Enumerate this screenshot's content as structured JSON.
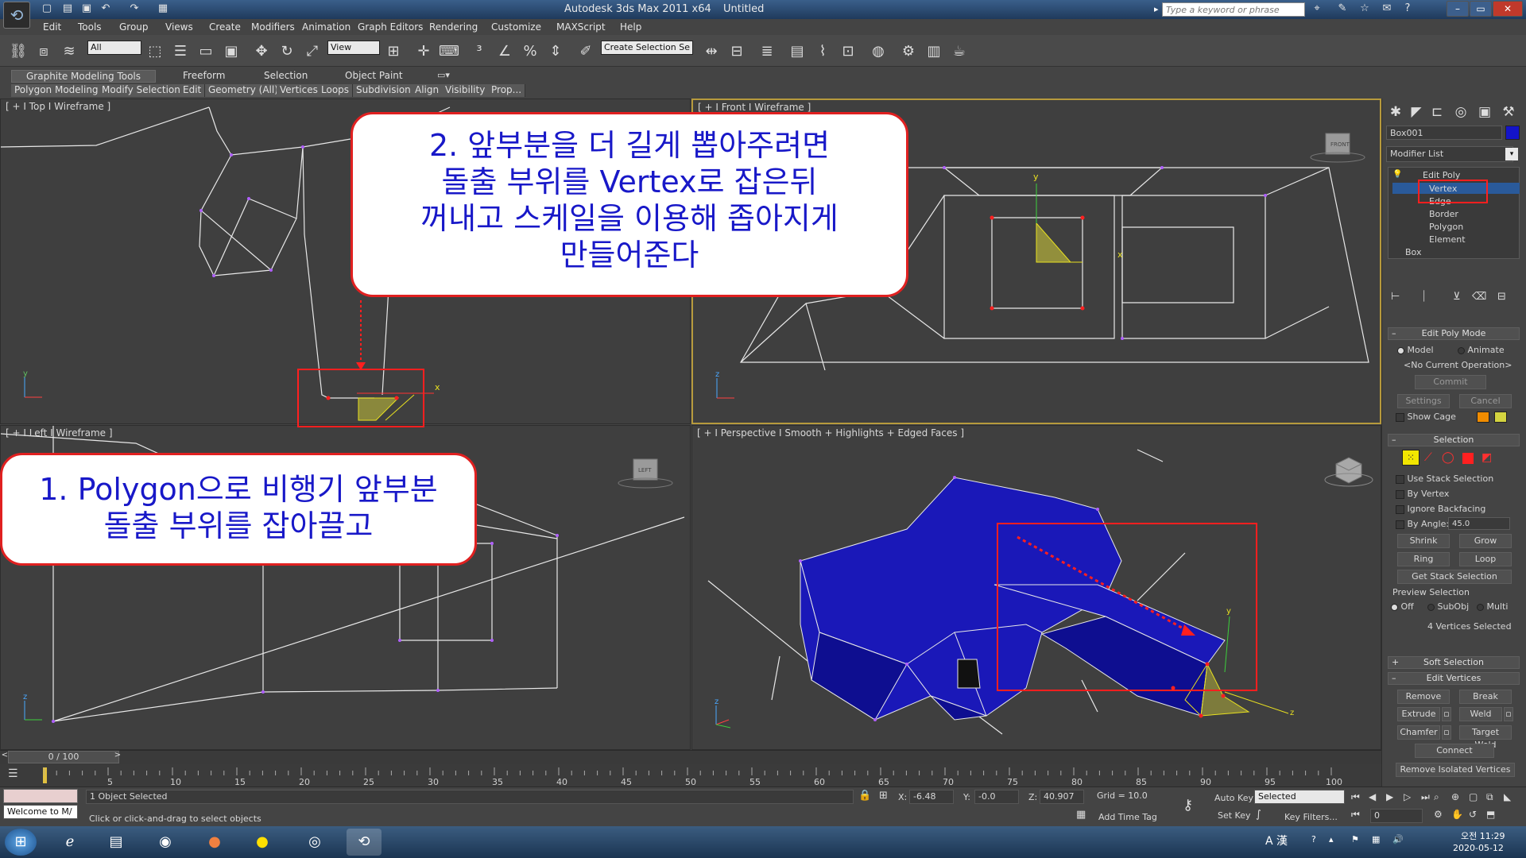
{
  "title_bar": {
    "app_title": "Autodesk 3ds Max  2011 x64",
    "document_title": "Untitled",
    "search_placeholder": "Type a keyword or phrase"
  },
  "menu": [
    "Edit",
    "Tools",
    "Group",
    "Views",
    "Create",
    "Modifiers",
    "Animation",
    "Graph Editors",
    "Rendering",
    "Customize",
    "MAXScript",
    "Help"
  ],
  "toolbar": {
    "selection_filter": "All",
    "reference_coord": "View",
    "named_selection_placeholder": "Create Selection Se"
  },
  "ribbon": {
    "tabs": [
      "Graphite Modeling Tools",
      "Freeform",
      "Selection",
      "Object Paint"
    ],
    "subtabs": [
      "Polygon Modeling",
      "Modify Selection",
      "Edit",
      "Geometry (All)",
      "Vertices",
      "Loops",
      "Subdivision",
      "Align",
      "Visibility",
      "Prop..."
    ]
  },
  "viewports": {
    "top": "[ + Ι Top Ι Wireframe ]",
    "front": "[ + Ι Front Ι Wireframe ]",
    "left": "[ + Ι Left Ι Wireframe ]",
    "perspective": "[ + Ι Perspective Ι Smooth + Highlights + Edged Faces ]",
    "viewcube_front": "FRONT",
    "viewcube_left": "LEFT"
  },
  "annotations": {
    "step1_line1": "1. Polygon으로 비행기 앞부분",
    "step1_line2": "돌출 부위를 잡아끌고",
    "step2_line1": "2. 앞부분을 더 길게 뽑아주려면",
    "step2_line2": "돌출 부위를 Vertex로 잡은뒤",
    "step2_line3": "꺼내고 스케일을 이용해 좁아지게",
    "step2_line4": "만들어준다"
  },
  "command_panel": {
    "object_name": "Box001",
    "object_color": "#1414c8",
    "modifier_list": "Modifier List",
    "stack": {
      "edit_poly": "Edit Poly",
      "subobjects": [
        "Vertex",
        "Edge",
        "Border",
        "Polygon",
        "Element"
      ],
      "base": "Box"
    },
    "edit_poly_mode": {
      "title": "Edit Poly Mode",
      "model": "Model",
      "animate": "Animate",
      "operation": "<No Current Operation>",
      "commit": "Commit",
      "settings": "Settings",
      "cancel": "Cancel",
      "show_cage": "Show Cage"
    },
    "selection": {
      "title": "Selection",
      "use_stack": "Use Stack Selection",
      "by_vertex": "By Vertex",
      "ignore_backfacing": "Ignore Backfacing",
      "by_angle": "By Angle:",
      "angle_value": "45.0",
      "shrink": "Shrink",
      "grow": "Grow",
      "ring": "Ring",
      "loop": "Loop",
      "get_stack": "Get Stack Selection",
      "preview": "Preview Selection",
      "preview_off": "Off",
      "preview_subobj": "SubObj",
      "preview_multi": "Multi",
      "status": "4 Vertices Selected"
    },
    "soft_selection": "Soft Selection",
    "edit_vertices": {
      "title": "Edit Vertices",
      "remove": "Remove",
      "break": "Break",
      "extrude": "Extrude",
      "weld": "Weld",
      "chamfer": "Chamfer",
      "target_weld": "Target Weld",
      "connect": "Connect",
      "remove_isolated": "Remove Isolated Vertices"
    }
  },
  "timeline": {
    "frame": "0 / 100",
    "ticks": [
      "5",
      "10",
      "15",
      "20",
      "25",
      "30",
      "35",
      "40",
      "45",
      "50",
      "55",
      "60",
      "65",
      "70",
      "75",
      "80",
      "85",
      "90",
      "95",
      "100"
    ]
  },
  "status": {
    "maxscript": "Welcome to M/",
    "selected": "1 Object Selected",
    "prompt": "Click or click-and-drag to select objects",
    "x_label": "X:",
    "x_value": "-6.48",
    "y_label": "Y:",
    "y_value": "-0.0",
    "z_label": "Z:",
    "z_value": "40.907",
    "grid": "Grid = 10.0",
    "add_time_tag": "Add Time Tag",
    "auto_key": "Auto Key",
    "set_key": "Set Key",
    "key_mode": "Selected",
    "key_filters": "Key Filters...",
    "current_frame": "0"
  },
  "taskbar": {
    "time": "오전 11:29",
    "date": "2020-05-12",
    "ime": "A 漢"
  },
  "colors": {
    "poly_blue": "#1a18b8",
    "wire_white": "#e8e8e8",
    "selection_yellow": "#e8e020",
    "callout_red": "#e02020",
    "callout_text": "#1818c8"
  }
}
